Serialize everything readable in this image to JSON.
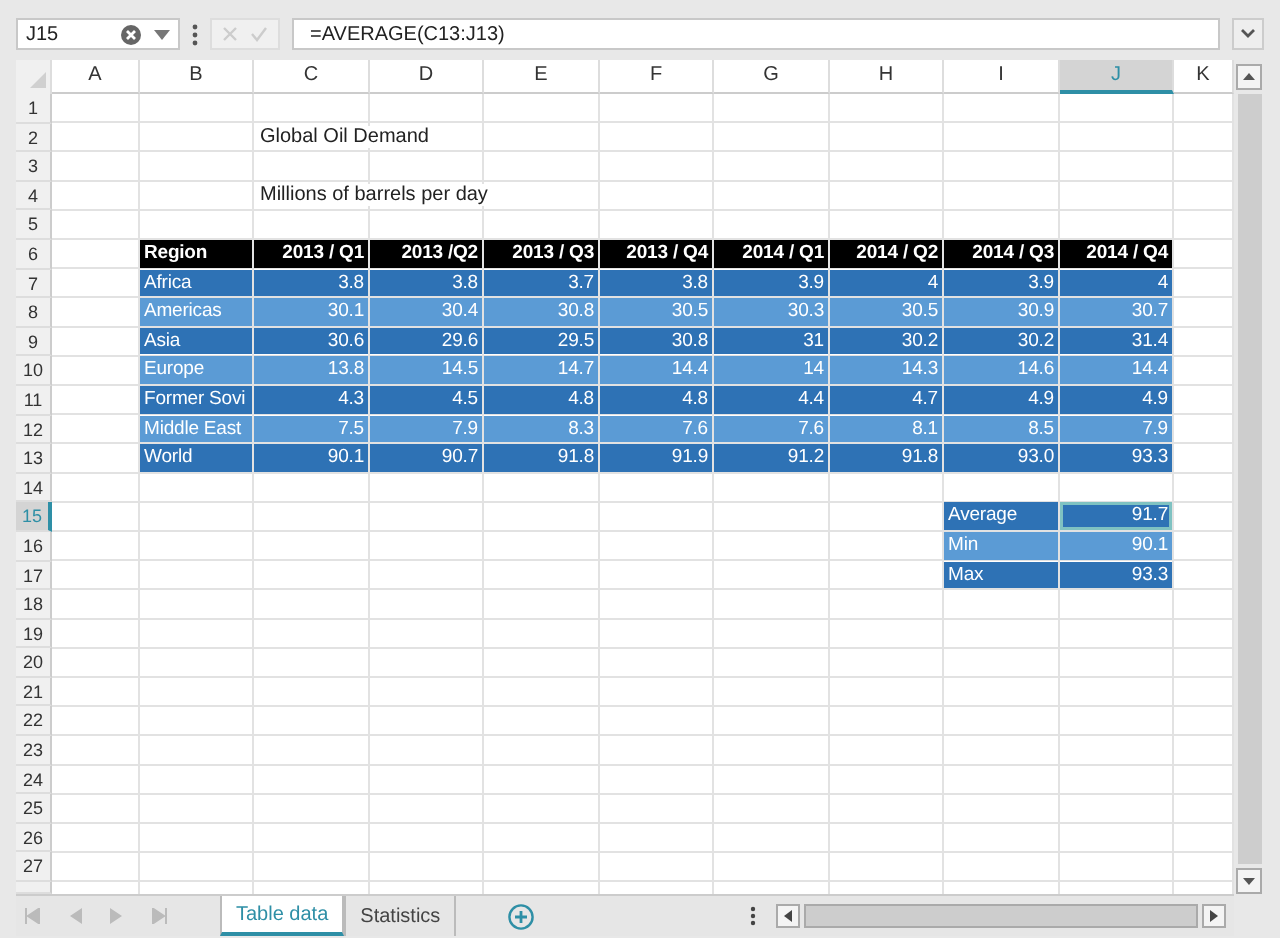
{
  "name_box": {
    "value": "J15"
  },
  "formula_bar": {
    "value": "=AVERAGE(C13:J13)"
  },
  "columns": [
    {
      "label": "A",
      "selected": false
    },
    {
      "label": "B",
      "selected": false
    },
    {
      "label": "C",
      "selected": false
    },
    {
      "label": "D",
      "selected": false
    },
    {
      "label": "E",
      "selected": false
    },
    {
      "label": "F",
      "selected": false
    },
    {
      "label": "G",
      "selected": false
    },
    {
      "label": "H",
      "selected": false
    },
    {
      "label": "I",
      "selected": false
    },
    {
      "label": "J",
      "selected": true
    },
    {
      "label": "K",
      "selected": false
    }
  ],
  "rows": [
    {
      "label": "1",
      "selected": false
    },
    {
      "label": "2",
      "selected": false
    },
    {
      "label": "3",
      "selected": false
    },
    {
      "label": "4",
      "selected": false
    },
    {
      "label": "5",
      "selected": false
    },
    {
      "label": "6",
      "selected": false
    },
    {
      "label": "7",
      "selected": false
    },
    {
      "label": "8",
      "selected": false
    },
    {
      "label": "9",
      "selected": false
    },
    {
      "label": "10",
      "selected": false
    },
    {
      "label": "11",
      "selected": false
    },
    {
      "label": "12",
      "selected": false
    },
    {
      "label": "13",
      "selected": false
    },
    {
      "label": "14",
      "selected": false
    },
    {
      "label": "15",
      "selected": true
    },
    {
      "label": "16",
      "selected": false
    },
    {
      "label": "17",
      "selected": false
    },
    {
      "label": "18",
      "selected": false
    },
    {
      "label": "19",
      "selected": false
    },
    {
      "label": "20",
      "selected": false
    },
    {
      "label": "21",
      "selected": false
    },
    {
      "label": "22",
      "selected": false
    },
    {
      "label": "23",
      "selected": false
    },
    {
      "label": "24",
      "selected": false
    },
    {
      "label": "25",
      "selected": false
    },
    {
      "label": "26",
      "selected": false
    },
    {
      "label": "27",
      "selected": false
    }
  ],
  "title": "Global Oil Demand",
  "subtitle": "Millions of barrels per day",
  "table": {
    "columns": [
      "Region",
      "2013 / Q1",
      "2013 /Q2",
      "2013 / Q3",
      "2013 / Q4",
      "2014 / Q1",
      "2014 / Q2",
      "2014 / Q3",
      "2014 / Q4"
    ],
    "rows": [
      {
        "region": "Africa",
        "values": [
          "3.8",
          "3.8",
          "3.7",
          "3.8",
          "3.9",
          "4",
          "3.9",
          "4"
        ]
      },
      {
        "region": "Americas",
        "values": [
          "30.1",
          "30.4",
          "30.8",
          "30.5",
          "30.3",
          "30.5",
          "30.9",
          "30.7"
        ]
      },
      {
        "region": "Asia",
        "values": [
          "30.6",
          "29.6",
          "29.5",
          "30.8",
          "31",
          "30.2",
          "30.2",
          "31.4"
        ]
      },
      {
        "region": "Europe",
        "values": [
          "13.8",
          "14.5",
          "14.7",
          "14.4",
          "14",
          "14.3",
          "14.6",
          "14.4"
        ]
      },
      {
        "region": "Former Sovi",
        "values": [
          "4.3",
          "4.5",
          "4.8",
          "4.8",
          "4.4",
          "4.7",
          "4.9",
          "4.9"
        ]
      },
      {
        "region": "Middle East",
        "values": [
          "7.5",
          "7.9",
          "8.3",
          "7.6",
          "7.6",
          "8.1",
          "8.5",
          "7.9"
        ]
      },
      {
        "region": "World",
        "values": [
          "90.1",
          "90.7",
          "91.8",
          "91.9",
          "91.2",
          "91.8",
          "93.0",
          "93.3"
        ]
      }
    ]
  },
  "stats": [
    {
      "label": "Average",
      "value": "91.7",
      "selected": true
    },
    {
      "label": "Min",
      "value": "90.1",
      "selected": false
    },
    {
      "label": "Max",
      "value": "93.3",
      "selected": false
    }
  ],
  "sheet_tabs": [
    {
      "label": "Table data",
      "selected": true
    },
    {
      "label": "Statistics",
      "selected": false
    }
  ]
}
